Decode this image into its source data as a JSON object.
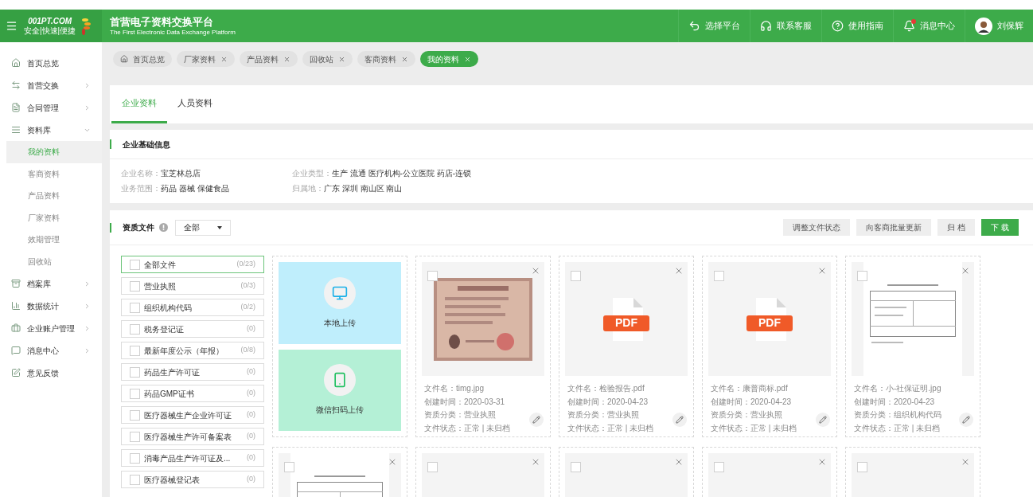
{
  "header": {
    "logo_text": "001PT.COM",
    "logo_slogan": "安全|快速|便捷",
    "title": "首营电子资料交换平台",
    "subtitle": "The First Electronic Data Exchange Platform",
    "nav": [
      {
        "kind": "back",
        "label": "选择平台",
        "badge": false
      },
      {
        "kind": "headset",
        "label": "联系客服",
        "badge": false
      },
      {
        "kind": "help",
        "label": "使用指南",
        "badge": false
      },
      {
        "kind": "bell",
        "label": "消息中心",
        "badge": true
      },
      {
        "kind": "user",
        "label": "刘保辉",
        "badge": false
      }
    ]
  },
  "sidebar": {
    "items": [
      {
        "kind": "home",
        "label": "首页总览"
      },
      {
        "kind": "exchange",
        "label": "首营交换",
        "expanded": false
      },
      {
        "kind": "contract",
        "label": "合同管理",
        "expanded": false
      },
      {
        "kind": "library",
        "label": "资料库",
        "expanded": true,
        "children": [
          {
            "label": "我的资料",
            "selected": true
          },
          {
            "label": "客商资料",
            "selected": false
          },
          {
            "label": "产品资料",
            "selected": false
          },
          {
            "label": "厂家资料",
            "selected": false
          },
          {
            "label": "效期管理",
            "selected": false
          },
          {
            "label": "回收站",
            "selected": false
          }
        ]
      },
      {
        "kind": "archive",
        "label": "档案库",
        "expanded": false
      },
      {
        "kind": "chart",
        "label": "数据统计",
        "expanded": false
      },
      {
        "kind": "account",
        "label": "企业账户管理",
        "expanded": false
      },
      {
        "kind": "message",
        "label": "消息中心",
        "expanded": false
      },
      {
        "kind": "feedback",
        "label": "意见反馈"
      }
    ]
  },
  "tags": [
    {
      "label": "首页总览",
      "closable": false,
      "selected": false
    },
    {
      "label": "厂家资料",
      "closable": true,
      "selected": false
    },
    {
      "label": "产品资料",
      "closable": true,
      "selected": false
    },
    {
      "label": "回收站",
      "closable": true,
      "selected": false
    },
    {
      "label": "客商资料",
      "closable": true,
      "selected": false
    },
    {
      "label": "我的资料",
      "closable": true,
      "selected": true
    }
  ],
  "tabs": [
    {
      "label": "企业资料",
      "selected": true
    },
    {
      "label": "人员资料",
      "selected": false
    }
  ],
  "basic_info": {
    "title": "企业基础信息",
    "fields": [
      {
        "label": "企业名称：",
        "value": "宝芝林总店"
      },
      {
        "label": "企业类型：",
        "value": "生产 流通 医疗机构-公立医院 药店-连锁"
      },
      {
        "label": "业务范围：",
        "value": "药品 器械 保健食品"
      },
      {
        "label": "归属地：",
        "value": "广东 深圳 南山区 南山"
      }
    ]
  },
  "documents": {
    "title": "资质文件",
    "filter": "全部",
    "buttons": [
      {
        "label": "调整文件状态",
        "kind": "default"
      },
      {
        "label": "向客商批量更新",
        "kind": "default"
      },
      {
        "label": "归 档",
        "kind": "default"
      },
      {
        "label": "下 载",
        "kind": "primary"
      }
    ],
    "categories": [
      {
        "label": "全部文件",
        "count": "(0/23)",
        "selected": true,
        "checked": false
      },
      {
        "label": "营业执照",
        "count": "(0/3)",
        "selected": false,
        "checked": false
      },
      {
        "label": "组织机构代码",
        "count": "(0/2)",
        "selected": false,
        "checked": false
      },
      {
        "label": "税务登记证",
        "count": "(0)",
        "selected": false,
        "checked": false
      },
      {
        "label": "最新年度公示（年报）",
        "count": "(0/8)",
        "selected": false,
        "checked": false
      },
      {
        "label": "药品生产许可证",
        "count": "(0)",
        "selected": false,
        "checked": false
      },
      {
        "label": "药品GMP证书",
        "count": "(0)",
        "selected": false,
        "checked": false
      },
      {
        "label": "医疗器械生产企业许可证",
        "count": "(0)",
        "selected": false,
        "checked": false
      },
      {
        "label": "医疗器械生产许可备案表",
        "count": "(0)",
        "selected": false,
        "checked": false
      },
      {
        "label": "消毒产品生产许可证及...",
        "count": "(0)",
        "selected": false,
        "checked": false
      },
      {
        "label": "医疗器械登记表",
        "count": "(0)",
        "selected": false,
        "checked": false
      }
    ],
    "uploads": [
      {
        "kind": "local",
        "label": "本地上传"
      },
      {
        "kind": "wechat",
        "label": "微信扫码上传"
      }
    ],
    "files": [
      {
        "checked": false,
        "lines": [
          "文件名：timg.jpg",
          "创建时间：2020-03-31",
          "资质分类：营业执照",
          "文件状态：正常 | 未归档"
        ]
      },
      {
        "kind": "pdf",
        "pdf_label": "PDF",
        "checked": false,
        "lines": [
          "文件名：检验报告.pdf",
          "创建时间：2020-04-23",
          "资质分类：营业执照",
          "文件状态：正常 | 未归档"
        ]
      },
      {
        "kind": "pdf",
        "pdf_label": "PDF",
        "checked": false,
        "lines": [
          "文件名：康普商标.pdf",
          "创建时间：2020-04-23",
          "资质分类：营业执照",
          "文件状态：正常 | 未归档"
        ]
      },
      {
        "kind": "document",
        "checked": false,
        "lines": [
          "文件名：小-社保证明.jpg",
          "创建时间：2020-04-23",
          "资质分类：组织机构代码",
          "文件状态：正常 | 未归档"
        ]
      }
    ],
    "files_more": [
      {
        "kind": "document",
        "checked": false
      },
      {
        "kind": "blank",
        "checked": false
      },
      {
        "kind": "blank",
        "checked": false
      },
      {
        "kind": "blank",
        "checked": false
      },
      {
        "kind": "blank",
        "checked": false
      }
    ]
  }
}
